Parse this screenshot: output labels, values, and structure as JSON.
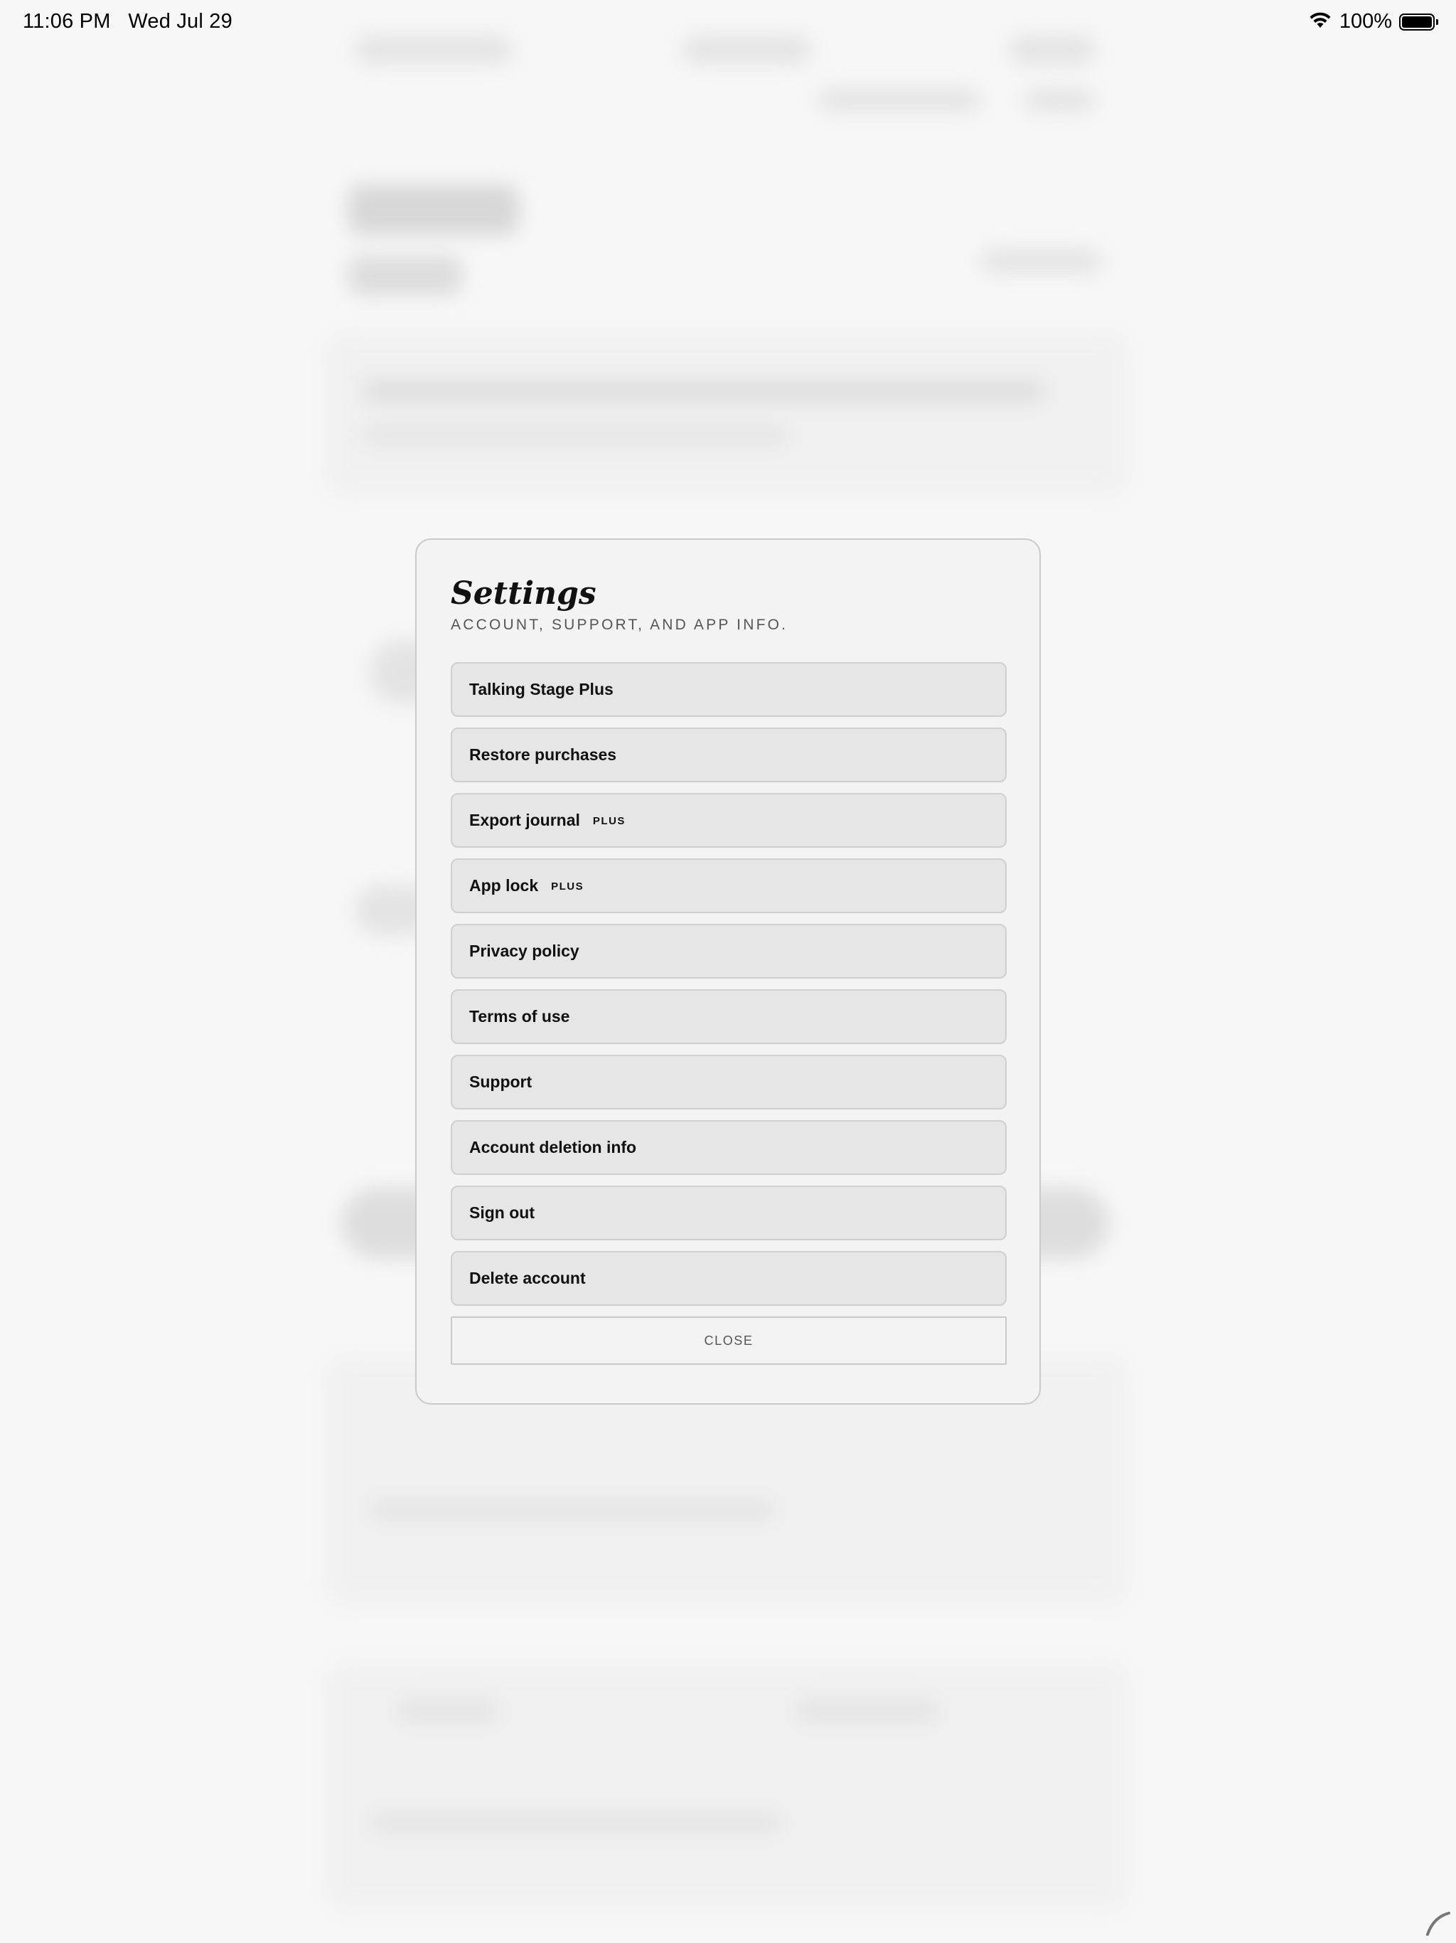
{
  "status_bar": {
    "time": "11:06 PM",
    "date": "Wed Jul 29",
    "battery_percent": "100%",
    "battery_level": 1.0,
    "wifi_icon": "wifi-icon",
    "battery_icon": "battery-icon"
  },
  "settings_modal": {
    "title": "Settings",
    "subtitle": "ACCOUNT, SUPPORT, AND APP INFO.",
    "items": [
      {
        "label": "Talking Stage Plus",
        "badge": ""
      },
      {
        "label": "Restore purchases",
        "badge": ""
      },
      {
        "label": "Export journal",
        "badge": "PLUS"
      },
      {
        "label": "App lock",
        "badge": "PLUS"
      },
      {
        "label": "Privacy policy",
        "badge": ""
      },
      {
        "label": "Terms of use",
        "badge": ""
      },
      {
        "label": "Support",
        "badge": ""
      },
      {
        "label": "Account deletion info",
        "badge": ""
      },
      {
        "label": "Sign out",
        "badge": ""
      },
      {
        "label": "Delete account",
        "badge": ""
      }
    ],
    "close_label": "CLOSE"
  }
}
